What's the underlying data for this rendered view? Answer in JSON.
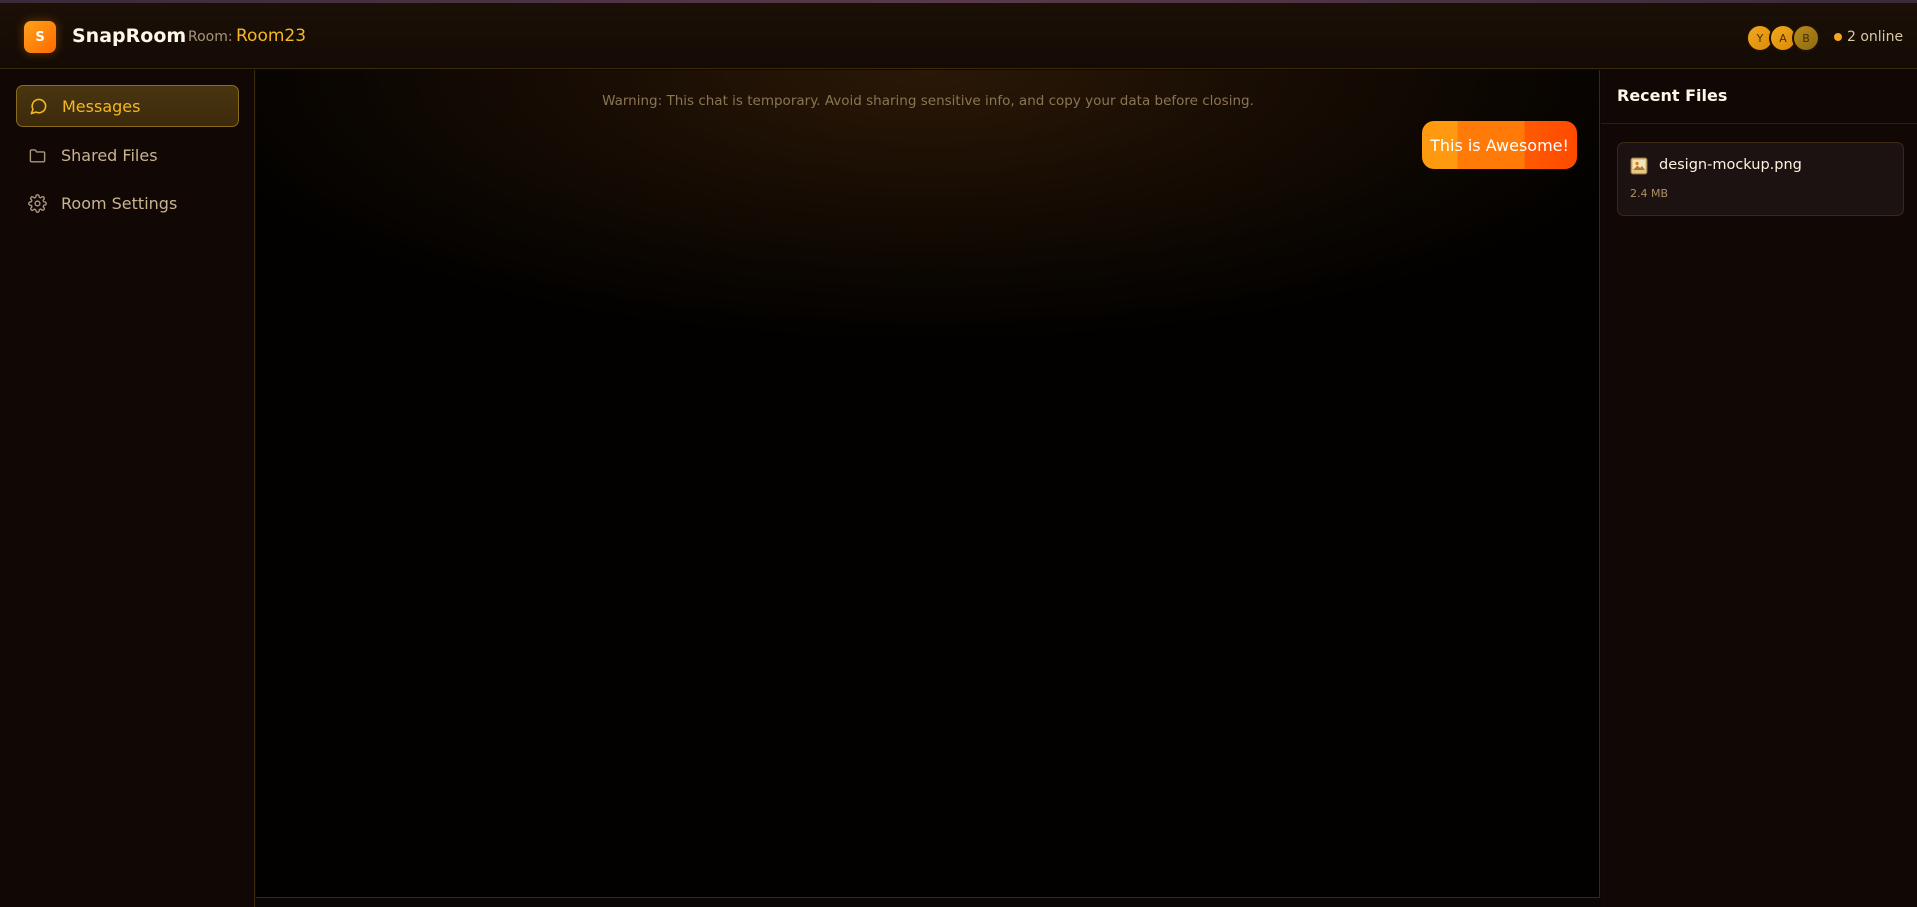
{
  "header": {
    "logo_letter": "S",
    "app_name": "SnapRoom",
    "room_label": "Room:",
    "room_name": "Room23",
    "avatars": [
      "Y",
      "A",
      "B"
    ],
    "online_text": "2 online"
  },
  "sidebar": {
    "items": [
      {
        "label": "Messages",
        "icon": "chat-bubble-icon",
        "active": true
      },
      {
        "label": "Shared Files",
        "icon": "folder-icon",
        "active": false
      },
      {
        "label": "Room Settings",
        "icon": "gear-icon",
        "active": false
      }
    ]
  },
  "chat": {
    "warning": "Warning: This chat is temporary. Avoid sharing sensitive info, and copy your data before closing.",
    "messages": [
      {
        "text": "This is Awesome!",
        "own": true
      }
    ]
  },
  "files_panel": {
    "title": "Recent Files",
    "files": [
      {
        "name": "design-mockup.png",
        "size": "2.4 MB",
        "icon": "image-file-icon"
      }
    ]
  },
  "colors": {
    "accent": "#f5b823",
    "brand_gradient_start": "#ffa21a",
    "brand_gradient_end": "#ff6a00",
    "online_dot": "#f5a623"
  }
}
